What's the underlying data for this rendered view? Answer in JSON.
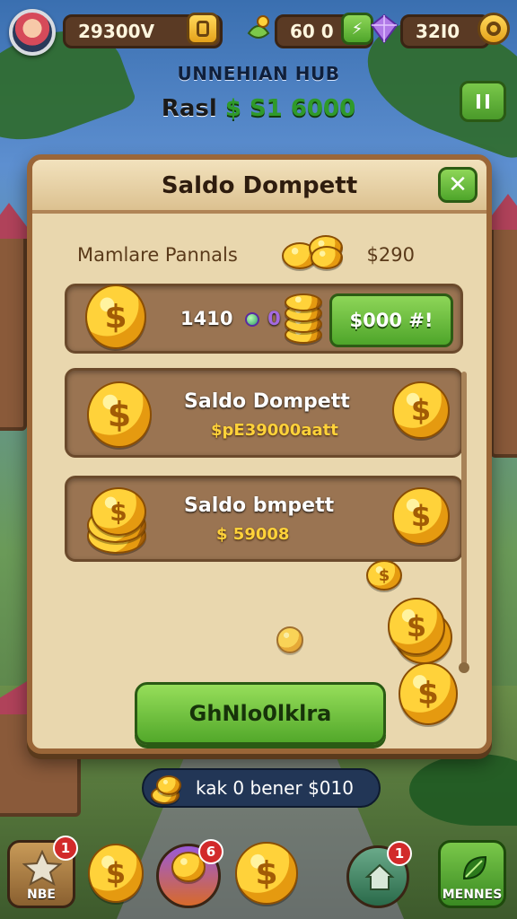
{
  "hud": {
    "coins": "29300V",
    "gems": "60 0",
    "crystals": "32I0",
    "pause_icon": "pause-icon",
    "colors": {
      "accent_green": "#4ea52a",
      "wood": "#9a6638",
      "gold": "#ffd23a"
    }
  },
  "hub": {
    "title": "UNNEHIAN HUB",
    "balance_label": "Rasl",
    "balance_value": "$ S1 6000"
  },
  "panel": {
    "title": "Saldo Dompett",
    "close_icon": "close-icon",
    "subheader_label": "Mamlare Pannals",
    "subheader_amount": "$290",
    "row1": {
      "amount": "1410",
      "suffix": "0",
      "button_label": "$000 #!"
    },
    "row2": {
      "title": "Saldo Dompett",
      "subtitle": "$pE39000aatt"
    },
    "row3": {
      "title": "Saldo bmpett",
      "subtitle": "$ 59008"
    },
    "collect_label": "GhNlo0lklra"
  },
  "notification": {
    "text": "kak 0 bener $010"
  },
  "nav": [
    {
      "label": "NBE",
      "badge": "1"
    },
    {
      "label": "",
      "badge": ""
    },
    {
      "label": "",
      "badge": "6"
    },
    {
      "label": "",
      "badge": ""
    },
    {
      "label": "",
      "badge": "1"
    },
    {
      "label": "MENNES",
      "badge": ""
    }
  ]
}
